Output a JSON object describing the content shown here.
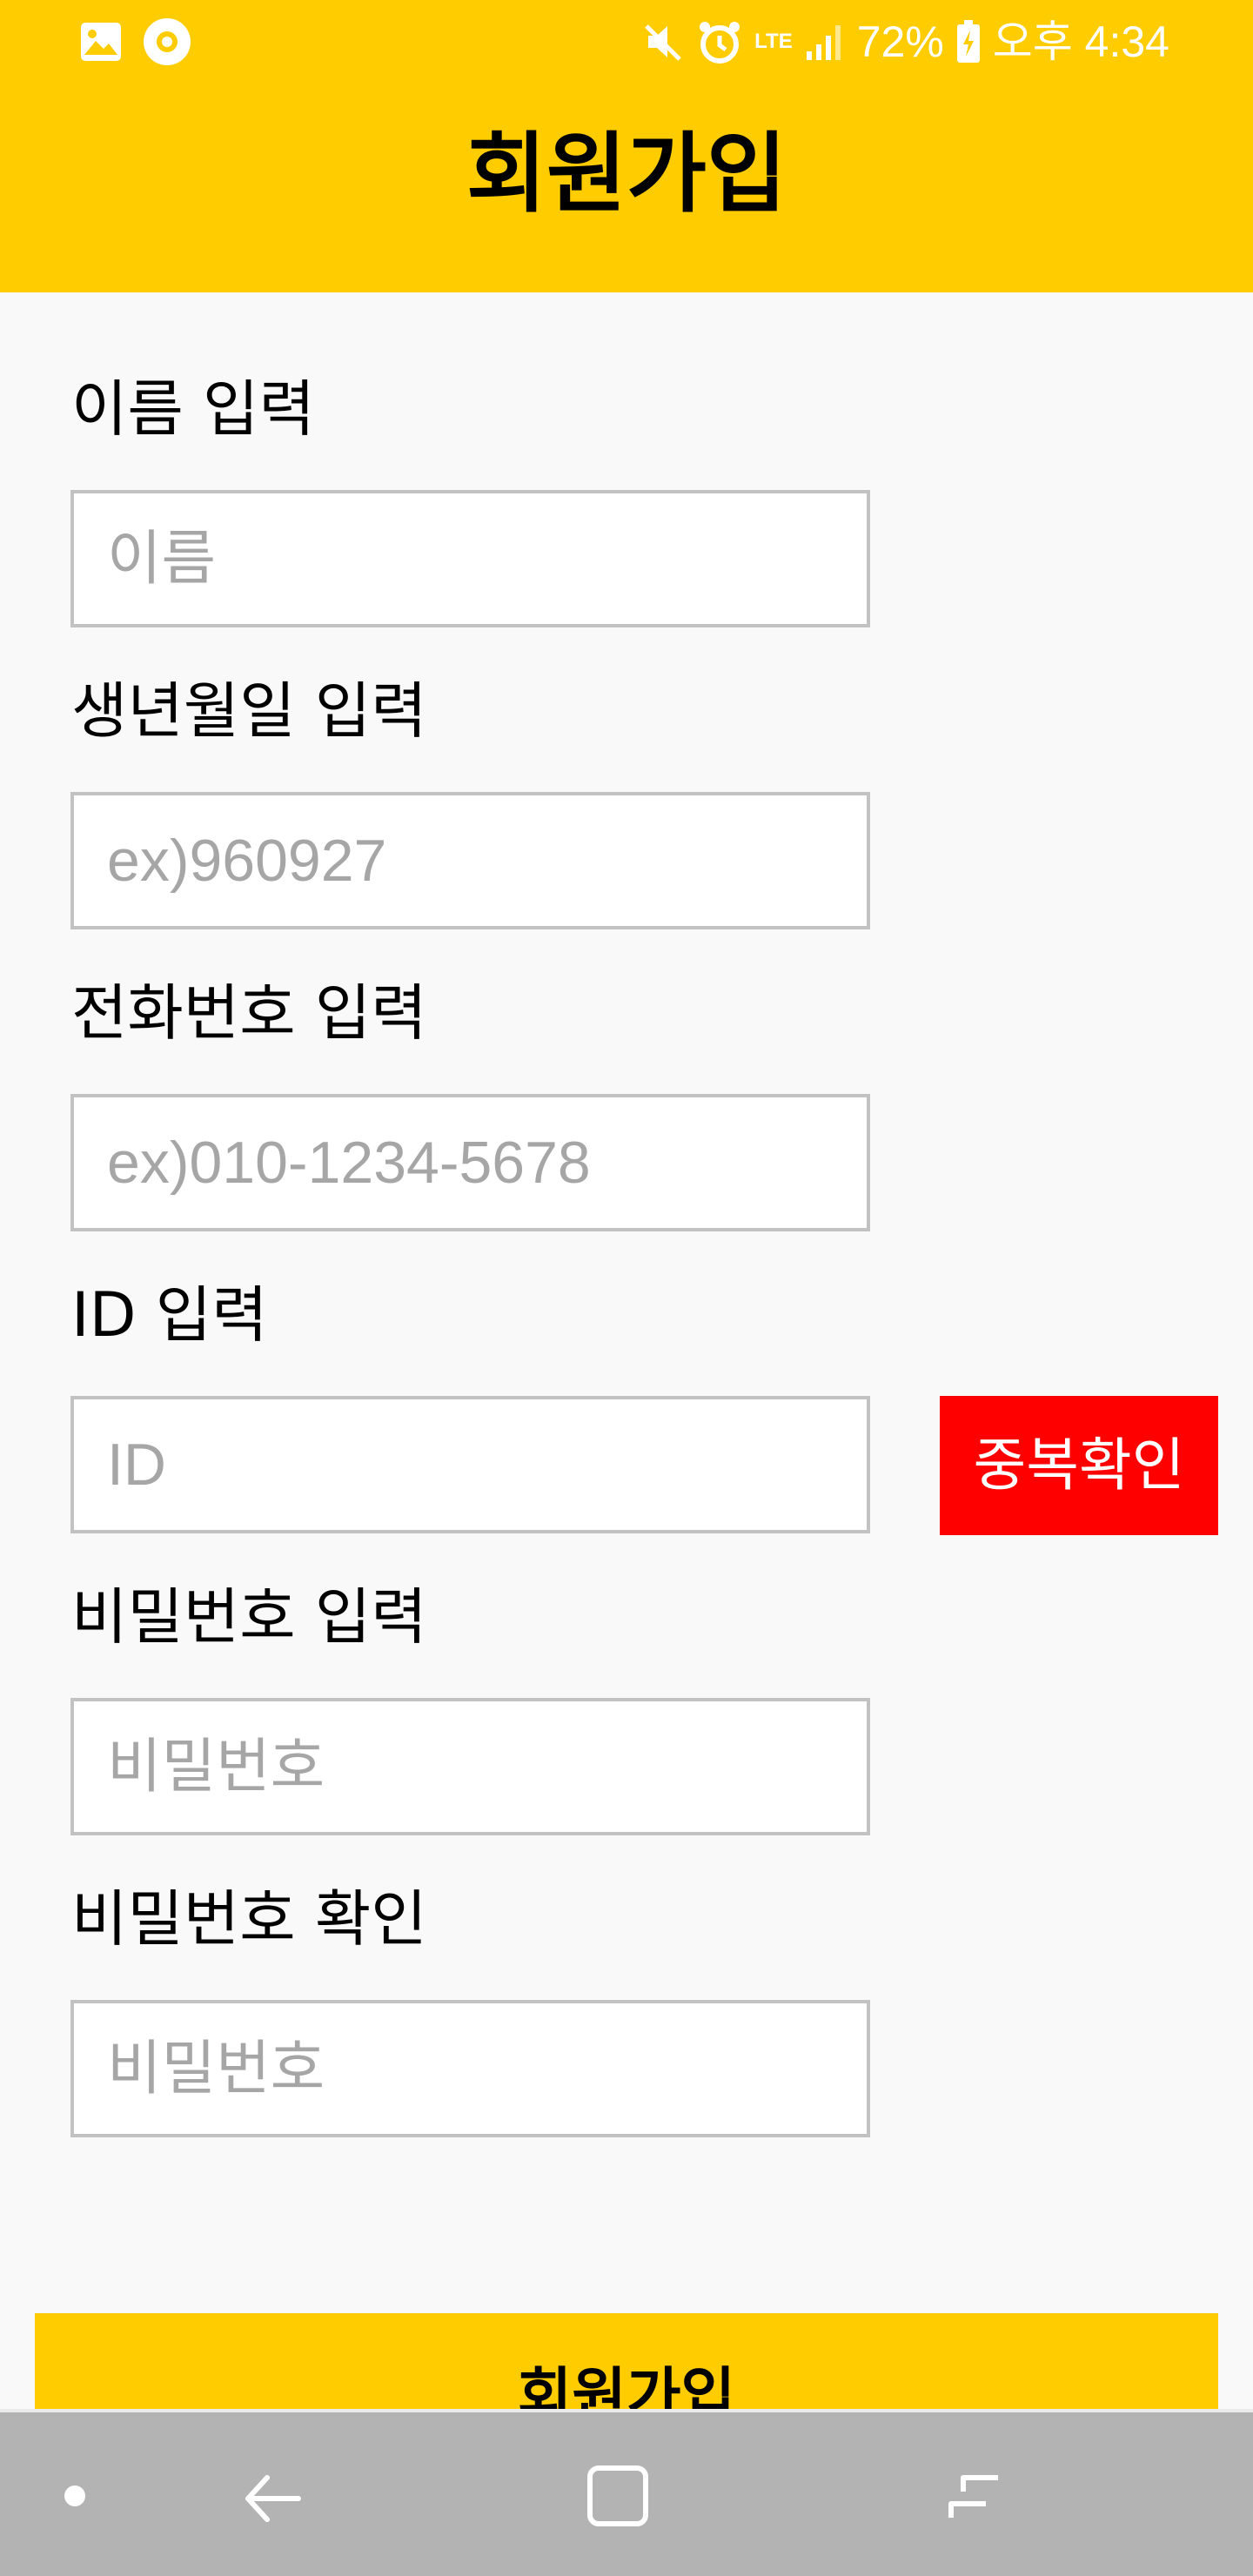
{
  "status_bar": {
    "network": "LTE",
    "battery_percent": "72%",
    "time": "오후 4:34",
    "icons": [
      "gallery-icon",
      "media-icon",
      "mute-icon",
      "alarm-icon",
      "lte-icon",
      "signal-icon",
      "battery-charging-icon"
    ]
  },
  "header": {
    "title": "회원가입"
  },
  "form": {
    "name": {
      "label": "이름 입력",
      "placeholder": "이름"
    },
    "birthdate": {
      "label": "생년월일 입력",
      "placeholder": "ex)960927"
    },
    "phone": {
      "label": "전화번호 입력",
      "placeholder": "ex)010-1234-5678"
    },
    "id": {
      "label": "ID 입력",
      "placeholder": "ID",
      "duplicate_check_label": "중복확인"
    },
    "password": {
      "label": "비밀번호 입력",
      "placeholder": "비밀번호"
    },
    "password_confirm": {
      "label": "비밀번호 확인",
      "placeholder": "비밀번호"
    },
    "submit_label": "회원가입"
  },
  "nav_bar": {
    "icons": [
      "dot-icon",
      "back-icon",
      "home-icon",
      "recents-icon"
    ]
  },
  "colors": {
    "header_bg": "#ffcc00",
    "page_bg": "#f9f9f9",
    "input_border": "#c2c2c2",
    "placeholder": "#a6a6a6",
    "duplicate_button_bg": "#ff0000",
    "submit_button_bg": "#ffcc00",
    "nav_bar_bg": "#b3b3b3"
  }
}
